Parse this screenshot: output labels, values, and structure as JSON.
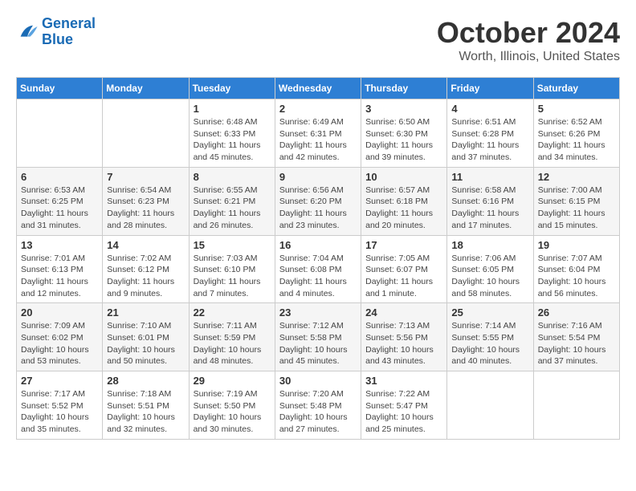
{
  "header": {
    "logo_general": "General",
    "logo_blue": "Blue",
    "month_title": "October 2024",
    "location": "Worth, Illinois, United States"
  },
  "weekdays": [
    "Sunday",
    "Monday",
    "Tuesday",
    "Wednesday",
    "Thursday",
    "Friday",
    "Saturday"
  ],
  "weeks": [
    [
      {
        "day": "",
        "info": ""
      },
      {
        "day": "",
        "info": ""
      },
      {
        "day": "1",
        "info": "Sunrise: 6:48 AM\nSunset: 6:33 PM\nDaylight: 11 hours and 45 minutes."
      },
      {
        "day": "2",
        "info": "Sunrise: 6:49 AM\nSunset: 6:31 PM\nDaylight: 11 hours and 42 minutes."
      },
      {
        "day": "3",
        "info": "Sunrise: 6:50 AM\nSunset: 6:30 PM\nDaylight: 11 hours and 39 minutes."
      },
      {
        "day": "4",
        "info": "Sunrise: 6:51 AM\nSunset: 6:28 PM\nDaylight: 11 hours and 37 minutes."
      },
      {
        "day": "5",
        "info": "Sunrise: 6:52 AM\nSunset: 6:26 PM\nDaylight: 11 hours and 34 minutes."
      }
    ],
    [
      {
        "day": "6",
        "info": "Sunrise: 6:53 AM\nSunset: 6:25 PM\nDaylight: 11 hours and 31 minutes."
      },
      {
        "day": "7",
        "info": "Sunrise: 6:54 AM\nSunset: 6:23 PM\nDaylight: 11 hours and 28 minutes."
      },
      {
        "day": "8",
        "info": "Sunrise: 6:55 AM\nSunset: 6:21 PM\nDaylight: 11 hours and 26 minutes."
      },
      {
        "day": "9",
        "info": "Sunrise: 6:56 AM\nSunset: 6:20 PM\nDaylight: 11 hours and 23 minutes."
      },
      {
        "day": "10",
        "info": "Sunrise: 6:57 AM\nSunset: 6:18 PM\nDaylight: 11 hours and 20 minutes."
      },
      {
        "day": "11",
        "info": "Sunrise: 6:58 AM\nSunset: 6:16 PM\nDaylight: 11 hours and 17 minutes."
      },
      {
        "day": "12",
        "info": "Sunrise: 7:00 AM\nSunset: 6:15 PM\nDaylight: 11 hours and 15 minutes."
      }
    ],
    [
      {
        "day": "13",
        "info": "Sunrise: 7:01 AM\nSunset: 6:13 PM\nDaylight: 11 hours and 12 minutes."
      },
      {
        "day": "14",
        "info": "Sunrise: 7:02 AM\nSunset: 6:12 PM\nDaylight: 11 hours and 9 minutes."
      },
      {
        "day": "15",
        "info": "Sunrise: 7:03 AM\nSunset: 6:10 PM\nDaylight: 11 hours and 7 minutes."
      },
      {
        "day": "16",
        "info": "Sunrise: 7:04 AM\nSunset: 6:08 PM\nDaylight: 11 hours and 4 minutes."
      },
      {
        "day": "17",
        "info": "Sunrise: 7:05 AM\nSunset: 6:07 PM\nDaylight: 11 hours and 1 minute."
      },
      {
        "day": "18",
        "info": "Sunrise: 7:06 AM\nSunset: 6:05 PM\nDaylight: 10 hours and 58 minutes."
      },
      {
        "day": "19",
        "info": "Sunrise: 7:07 AM\nSunset: 6:04 PM\nDaylight: 10 hours and 56 minutes."
      }
    ],
    [
      {
        "day": "20",
        "info": "Sunrise: 7:09 AM\nSunset: 6:02 PM\nDaylight: 10 hours and 53 minutes."
      },
      {
        "day": "21",
        "info": "Sunrise: 7:10 AM\nSunset: 6:01 PM\nDaylight: 10 hours and 50 minutes."
      },
      {
        "day": "22",
        "info": "Sunrise: 7:11 AM\nSunset: 5:59 PM\nDaylight: 10 hours and 48 minutes."
      },
      {
        "day": "23",
        "info": "Sunrise: 7:12 AM\nSunset: 5:58 PM\nDaylight: 10 hours and 45 minutes."
      },
      {
        "day": "24",
        "info": "Sunrise: 7:13 AM\nSunset: 5:56 PM\nDaylight: 10 hours and 43 minutes."
      },
      {
        "day": "25",
        "info": "Sunrise: 7:14 AM\nSunset: 5:55 PM\nDaylight: 10 hours and 40 minutes."
      },
      {
        "day": "26",
        "info": "Sunrise: 7:16 AM\nSunset: 5:54 PM\nDaylight: 10 hours and 37 minutes."
      }
    ],
    [
      {
        "day": "27",
        "info": "Sunrise: 7:17 AM\nSunset: 5:52 PM\nDaylight: 10 hours and 35 minutes."
      },
      {
        "day": "28",
        "info": "Sunrise: 7:18 AM\nSunset: 5:51 PM\nDaylight: 10 hours and 32 minutes."
      },
      {
        "day": "29",
        "info": "Sunrise: 7:19 AM\nSunset: 5:50 PM\nDaylight: 10 hours and 30 minutes."
      },
      {
        "day": "30",
        "info": "Sunrise: 7:20 AM\nSunset: 5:48 PM\nDaylight: 10 hours and 27 minutes."
      },
      {
        "day": "31",
        "info": "Sunrise: 7:22 AM\nSunset: 5:47 PM\nDaylight: 10 hours and 25 minutes."
      },
      {
        "day": "",
        "info": ""
      },
      {
        "day": "",
        "info": ""
      }
    ]
  ]
}
